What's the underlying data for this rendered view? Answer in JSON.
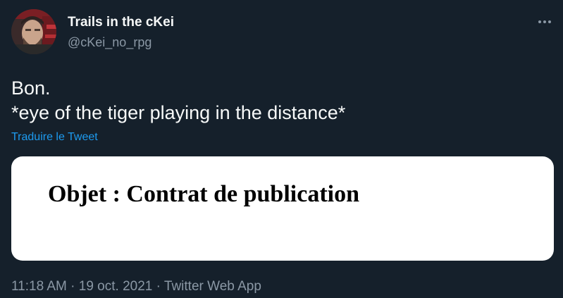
{
  "author": {
    "display_name": "Trails in the cKei",
    "handle": "@cKei_no_rpg"
  },
  "tweet": {
    "text": "Bon.\n*eye of the tiger playing in the distance*",
    "translate_label": "Traduire le Tweet"
  },
  "media": {
    "image_text": "Objet : Contrat de publication"
  },
  "meta": {
    "time": "11:18 AM",
    "separator": " · ",
    "date": "19 oct. 2021",
    "source": "Twitter Web App"
  },
  "icons": {
    "more": "more-horizontal-icon",
    "avatar": "avatar-image"
  },
  "colors": {
    "background": "#15202b",
    "primary_text": "#f7f9f9",
    "secondary_text": "#8b98a5",
    "link": "#1d9bf0"
  }
}
